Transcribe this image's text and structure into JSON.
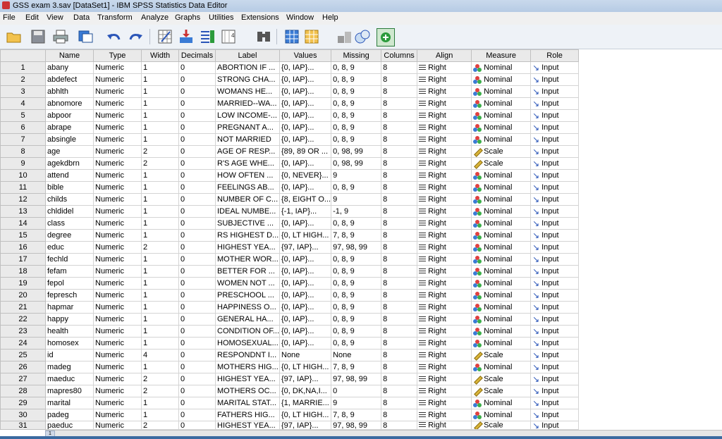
{
  "window": {
    "title": "GSS exam 3.sav [DataSet1] - IBM SPSS Statistics Data Editor"
  },
  "menu": [
    "File",
    "Edit",
    "View",
    "Data",
    "Transform",
    "Analyze",
    "Graphs",
    "Utilities",
    "Extensions",
    "Window",
    "Help"
  ],
  "toolbar_icons": [
    "open-folder-icon",
    "save-icon",
    "print-icon",
    "dialog-recall-icon",
    "undo-icon",
    "redo-icon",
    "go-to-case-icon",
    "go-to-variable-icon",
    "variables-icon",
    "run-descriptives-icon",
    "find-icon",
    "insert-cases-icon",
    "insert-variable-icon",
    "split-file-icon",
    "value-labels-icon",
    "use-sets-icon"
  ],
  "columns": [
    "Name",
    "Type",
    "Width",
    "Decimals",
    "Label",
    "Values",
    "Missing",
    "Columns",
    "Align",
    "Measure",
    "Role"
  ],
  "rows": [
    {
      "n": "1",
      "name": "abany",
      "type": "Numeric",
      "width": "1",
      "dec": "0",
      "label": "ABORTION IF ...",
      "values": "{0, IAP}...",
      "missing": "0, 8, 9",
      "cols": "8",
      "align": "Right",
      "measure": "Nominal",
      "role": "Input"
    },
    {
      "n": "2",
      "name": "abdefect",
      "type": "Numeric",
      "width": "1",
      "dec": "0",
      "label": "STRONG CHA...",
      "values": "{0, IAP}...",
      "missing": "0, 8, 9",
      "cols": "8",
      "align": "Right",
      "measure": "Nominal",
      "role": "Input"
    },
    {
      "n": "3",
      "name": "abhlth",
      "type": "Numeric",
      "width": "1",
      "dec": "0",
      "label": "WOMANS HE...",
      "values": "{0, IAP}...",
      "missing": "0, 8, 9",
      "cols": "8",
      "align": "Right",
      "measure": "Nominal",
      "role": "Input"
    },
    {
      "n": "4",
      "name": "abnomore",
      "type": "Numeric",
      "width": "1",
      "dec": "0",
      "label": "MARRIED--WA...",
      "values": "{0, IAP}...",
      "missing": "0, 8, 9",
      "cols": "8",
      "align": "Right",
      "measure": "Nominal",
      "role": "Input"
    },
    {
      "n": "5",
      "name": "abpoor",
      "type": "Numeric",
      "width": "1",
      "dec": "0",
      "label": "LOW INCOME-...",
      "values": "{0, IAP}...",
      "missing": "0, 8, 9",
      "cols": "8",
      "align": "Right",
      "measure": "Nominal",
      "role": "Input"
    },
    {
      "n": "6",
      "name": "abrape",
      "type": "Numeric",
      "width": "1",
      "dec": "0",
      "label": "PREGNANT A...",
      "values": "{0, IAP}...",
      "missing": "0, 8, 9",
      "cols": "8",
      "align": "Right",
      "measure": "Nominal",
      "role": "Input"
    },
    {
      "n": "7",
      "name": "absingle",
      "type": "Numeric",
      "width": "1",
      "dec": "0",
      "label": "NOT MARRIED",
      "values": "{0, IAP}...",
      "missing": "0, 8, 9",
      "cols": "8",
      "align": "Right",
      "measure": "Nominal",
      "role": "Input"
    },
    {
      "n": "8",
      "name": "age",
      "type": "Numeric",
      "width": "2",
      "dec": "0",
      "label": "AGE OF RESP...",
      "values": "{89, 89 OR ...",
      "missing": "0, 98, 99",
      "cols": "8",
      "align": "Right",
      "measure": "Scale",
      "role": "Input"
    },
    {
      "n": "9",
      "name": "agekdbrn",
      "type": "Numeric",
      "width": "2",
      "dec": "0",
      "label": "R'S AGE WHE...",
      "values": "{0, IAP}...",
      "missing": "0, 98, 99",
      "cols": "8",
      "align": "Right",
      "measure": "Scale",
      "role": "Input"
    },
    {
      "n": "10",
      "name": "attend",
      "type": "Numeric",
      "width": "1",
      "dec": "0",
      "label": "HOW OFTEN ...",
      "values": "{0, NEVER}...",
      "missing": "9",
      "cols": "8",
      "align": "Right",
      "measure": "Nominal",
      "role": "Input"
    },
    {
      "n": "11",
      "name": "bible",
      "type": "Numeric",
      "width": "1",
      "dec": "0",
      "label": "FEELINGS AB...",
      "values": "{0, IAP}...",
      "missing": "0, 8, 9",
      "cols": "8",
      "align": "Right",
      "measure": "Nominal",
      "role": "Input"
    },
    {
      "n": "12",
      "name": "childs",
      "type": "Numeric",
      "width": "1",
      "dec": "0",
      "label": "NUMBER OF C...",
      "values": "{8, EIGHT O...",
      "missing": "9",
      "cols": "8",
      "align": "Right",
      "measure": "Nominal",
      "role": "Input"
    },
    {
      "n": "13",
      "name": "chldidel",
      "type": "Numeric",
      "width": "1",
      "dec": "0",
      "label": "IDEAL NUMBE...",
      "values": "{-1, IAP}...",
      "missing": "-1, 9",
      "cols": "8",
      "align": "Right",
      "measure": "Nominal",
      "role": "Input"
    },
    {
      "n": "14",
      "name": "class",
      "type": "Numeric",
      "width": "1",
      "dec": "0",
      "label": "SUBJECTIVE ...",
      "values": "{0, IAP}...",
      "missing": "0, 8, 9",
      "cols": "8",
      "align": "Right",
      "measure": "Nominal",
      "role": "Input"
    },
    {
      "n": "15",
      "name": "degree",
      "type": "Numeric",
      "width": "1",
      "dec": "0",
      "label": "RS HIGHEST D...",
      "values": "{0, LT HIGH...",
      "missing": "7, 8, 9",
      "cols": "8",
      "align": "Right",
      "measure": "Nominal",
      "role": "Input"
    },
    {
      "n": "16",
      "name": "educ",
      "type": "Numeric",
      "width": "2",
      "dec": "0",
      "label": "HIGHEST YEA...",
      "values": "{97, IAP}...",
      "missing": "97, 98, 99",
      "cols": "8",
      "align": "Right",
      "measure": "Nominal",
      "role": "Input"
    },
    {
      "n": "17",
      "name": "fechld",
      "type": "Numeric",
      "width": "1",
      "dec": "0",
      "label": "MOTHER WOR...",
      "values": "{0, IAP}...",
      "missing": "0, 8, 9",
      "cols": "8",
      "align": "Right",
      "measure": "Nominal",
      "role": "Input"
    },
    {
      "n": "18",
      "name": "fefam",
      "type": "Numeric",
      "width": "1",
      "dec": "0",
      "label": "BETTER FOR ...",
      "values": "{0, IAP}...",
      "missing": "0, 8, 9",
      "cols": "8",
      "align": "Right",
      "measure": "Nominal",
      "role": "Input"
    },
    {
      "n": "19",
      "name": "fepol",
      "type": "Numeric",
      "width": "1",
      "dec": "0",
      "label": "WOMEN NOT ...",
      "values": "{0, IAP}...",
      "missing": "0, 8, 9",
      "cols": "8",
      "align": "Right",
      "measure": "Nominal",
      "role": "Input"
    },
    {
      "n": "20",
      "name": "fepresch",
      "type": "Numeric",
      "width": "1",
      "dec": "0",
      "label": "PRESCHOOL ...",
      "values": "{0, IAP}...",
      "missing": "0, 8, 9",
      "cols": "8",
      "align": "Right",
      "measure": "Nominal",
      "role": "Input"
    },
    {
      "n": "21",
      "name": "hapmar",
      "type": "Numeric",
      "width": "1",
      "dec": "0",
      "label": "HAPPINESS O...",
      "values": "{0, IAP}...",
      "missing": "0, 8, 9",
      "cols": "8",
      "align": "Right",
      "measure": "Nominal",
      "role": "Input"
    },
    {
      "n": "22",
      "name": "happy",
      "type": "Numeric",
      "width": "1",
      "dec": "0",
      "label": "GENERAL HA...",
      "values": "{0, IAP}...",
      "missing": "0, 8, 9",
      "cols": "8",
      "align": "Right",
      "measure": "Nominal",
      "role": "Input"
    },
    {
      "n": "23",
      "name": "health",
      "type": "Numeric",
      "width": "1",
      "dec": "0",
      "label": "CONDITION OF...",
      "values": "{0, IAP}...",
      "missing": "0, 8, 9",
      "cols": "8",
      "align": "Right",
      "measure": "Nominal",
      "role": "Input"
    },
    {
      "n": "24",
      "name": "homosex",
      "type": "Numeric",
      "width": "1",
      "dec": "0",
      "label": "HOMOSEXUAL...",
      "values": "{0, IAP}...",
      "missing": "0, 8, 9",
      "cols": "8",
      "align": "Right",
      "measure": "Nominal",
      "role": "Input"
    },
    {
      "n": "25",
      "name": "id",
      "type": "Numeric",
      "width": "4",
      "dec": "0",
      "label": "RESPONDNT I...",
      "values": "None",
      "missing": "None",
      "cols": "8",
      "align": "Right",
      "measure": "Scale",
      "role": "Input"
    },
    {
      "n": "26",
      "name": "madeg",
      "type": "Numeric",
      "width": "1",
      "dec": "0",
      "label": "MOTHERS HIG...",
      "values": "{0, LT HIGH...",
      "missing": "7, 8, 9",
      "cols": "8",
      "align": "Right",
      "measure": "Nominal",
      "role": "Input"
    },
    {
      "n": "27",
      "name": "maeduc",
      "type": "Numeric",
      "width": "2",
      "dec": "0",
      "label": "HIGHEST YEA...",
      "values": "{97, IAP}...",
      "missing": "97, 98, 99",
      "cols": "8",
      "align": "Right",
      "measure": "Scale",
      "role": "Input"
    },
    {
      "n": "28",
      "name": "mapres80",
      "type": "Numeric",
      "width": "2",
      "dec": "0",
      "label": "MOTHERS OC...",
      "values": "{0, DK,NA,I...",
      "missing": "0",
      "cols": "8",
      "align": "Right",
      "measure": "Scale",
      "role": "Input"
    },
    {
      "n": "29",
      "name": "marital",
      "type": "Numeric",
      "width": "1",
      "dec": "0",
      "label": "MARITAL STAT...",
      "values": "{1, MARRIE...",
      "missing": "9",
      "cols": "8",
      "align": "Right",
      "measure": "Nominal",
      "role": "Input"
    },
    {
      "n": "30",
      "name": "padeg",
      "type": "Numeric",
      "width": "1",
      "dec": "0",
      "label": "FATHERS HIG...",
      "values": "{0, LT HIGH...",
      "missing": "7, 8, 9",
      "cols": "8",
      "align": "Right",
      "measure": "Nominal",
      "role": "Input"
    },
    {
      "n": "31",
      "name": "paeduc",
      "type": "Numeric",
      "width": "2",
      "dec": "0",
      "label": "HIGHEST YEA...",
      "values": "{97, IAP}...",
      "missing": "97, 98, 99",
      "cols": "8",
      "align": "Right",
      "measure": "Scale",
      "role": "Input"
    }
  ],
  "scrollbar_label": "1"
}
